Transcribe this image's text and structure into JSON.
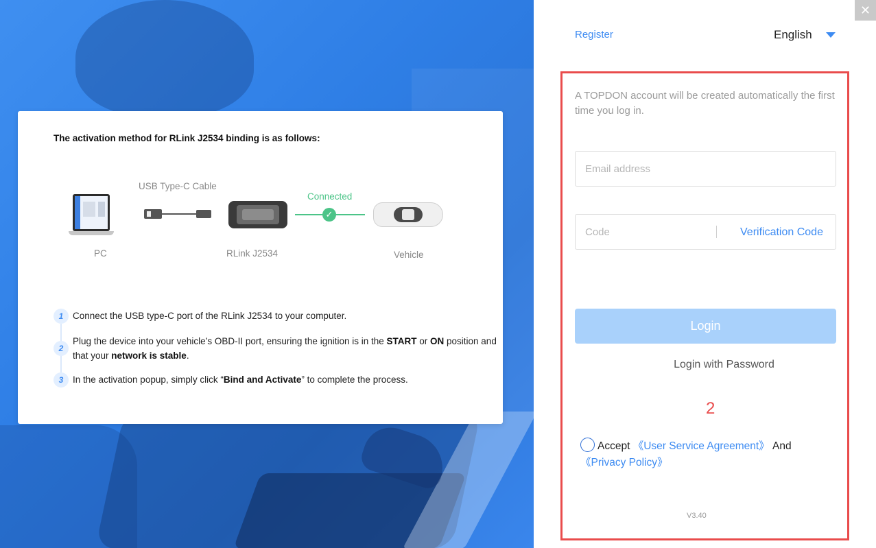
{
  "window": {
    "close_glyph": "✕"
  },
  "info": {
    "title": "The activation method for RLink J2534 binding is as follows:",
    "diagram": {
      "cable_label": "USB Type-C Cable",
      "connected_label": "Connected",
      "pc_label": "PC",
      "device_label": "RLink J2534",
      "vehicle_label": "Vehicle",
      "status_color": "#4cc488"
    },
    "steps": [
      {
        "num": "1",
        "parts": [
          "Connect the USB type-C port of the RLink J2534 to your computer."
        ]
      },
      {
        "num": "2",
        "parts": [
          "Plug the device into your vehicle’s OBD-II port, ensuring the ignition is in the ",
          "START",
          " or ",
          "ON",
          " position and that your ",
          "network is stable",
          "."
        ]
      },
      {
        "num": "3",
        "parts": [
          "In the activation popup, simply click “",
          "Bind and Activate",
          "” to complete the process."
        ]
      }
    ]
  },
  "header": {
    "register_label": "Register",
    "language": "English"
  },
  "login": {
    "hint": "A TOPDON account will be created automatically the first time you log in.",
    "email_placeholder": "Email address",
    "code_placeholder": "Code",
    "verify_label": "Verification Code",
    "login_label": "Login",
    "password_login_label": "Login with Password",
    "annotation": "2",
    "agree": {
      "accept": "Accept",
      "service_link": "《User Service Agreement》",
      "and": "And",
      "privacy_link": "《Privacy Policy》"
    },
    "version": "V3.40"
  },
  "colors": {
    "accent": "#3d8bf2",
    "login_button": "#a9d1fb",
    "highlight_border": "#e94c4c"
  },
  "icons": {
    "close": "close-icon",
    "language_caret": "caret-down-icon",
    "connected_check": "check-icon",
    "radio": "radio-unchecked-icon"
  }
}
